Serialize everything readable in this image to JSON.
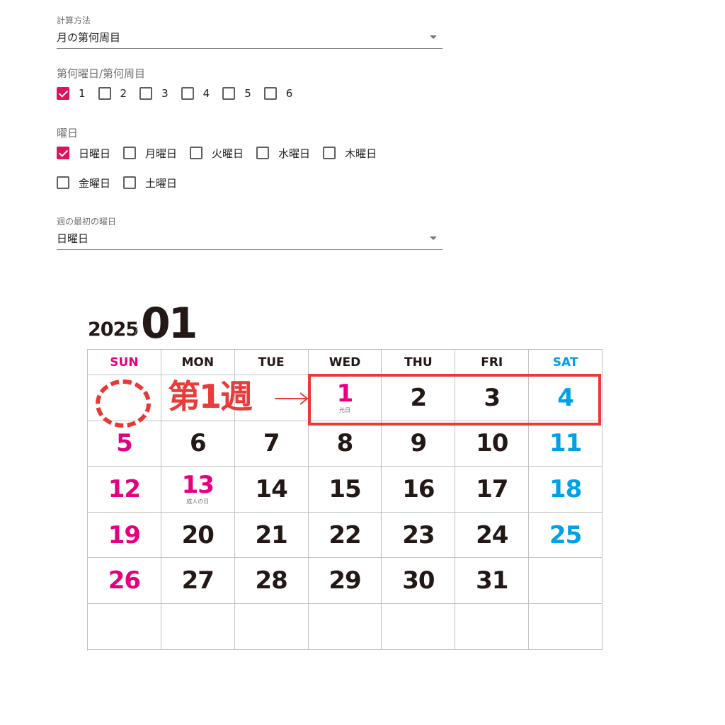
{
  "form": {
    "calc_method": {
      "label": "計算方法",
      "value": "月の第何周目"
    },
    "nth_week": {
      "label": "第何曜日/第何周目",
      "options": [
        {
          "label": "1",
          "checked": true
        },
        {
          "label": "2",
          "checked": false
        },
        {
          "label": "3",
          "checked": false
        },
        {
          "label": "4",
          "checked": false
        },
        {
          "label": "5",
          "checked": false
        },
        {
          "label": "6",
          "checked": false
        }
      ]
    },
    "weekdays": {
      "label": "曜日",
      "options": [
        {
          "label": "日曜日",
          "checked": true
        },
        {
          "label": "月曜日",
          "checked": false
        },
        {
          "label": "火曜日",
          "checked": false
        },
        {
          "label": "水曜日",
          "checked": false
        },
        {
          "label": "木曜日",
          "checked": false
        },
        {
          "label": "金曜日",
          "checked": false
        },
        {
          "label": "土曜日",
          "checked": false
        }
      ]
    },
    "week_start": {
      "label": "週の最初の曜日",
      "value": "日曜日"
    }
  },
  "calendar": {
    "year": "2025",
    "slash": "/",
    "month": "01",
    "weekday_headers": [
      "SUN",
      "MON",
      "TUE",
      "WED",
      "THU",
      "FRI",
      "SAT"
    ],
    "weeks": [
      [
        "",
        "",
        "",
        "1",
        "2",
        "3",
        "4"
      ],
      [
        "5",
        "6",
        "7",
        "8",
        "9",
        "10",
        "11"
      ],
      [
        "12",
        "13",
        "14",
        "15",
        "16",
        "17",
        "18"
      ],
      [
        "19",
        "20",
        "21",
        "22",
        "23",
        "24",
        "25"
      ],
      [
        "26",
        "27",
        "28",
        "29",
        "30",
        "31",
        ""
      ],
      [
        "",
        "",
        "",
        "",
        "",
        "",
        ""
      ]
    ],
    "holidays": {
      "1": "元日",
      "13": "成人の日"
    },
    "colors": {
      "sunday": "#e4007f",
      "saturday": "#00a0e9",
      "weekday": "#231815",
      "grid": "#c2c2c2"
    }
  },
  "annotation": {
    "label": "第1週",
    "color": "#ea3b3b"
  },
  "accent_color": "#e0125f"
}
